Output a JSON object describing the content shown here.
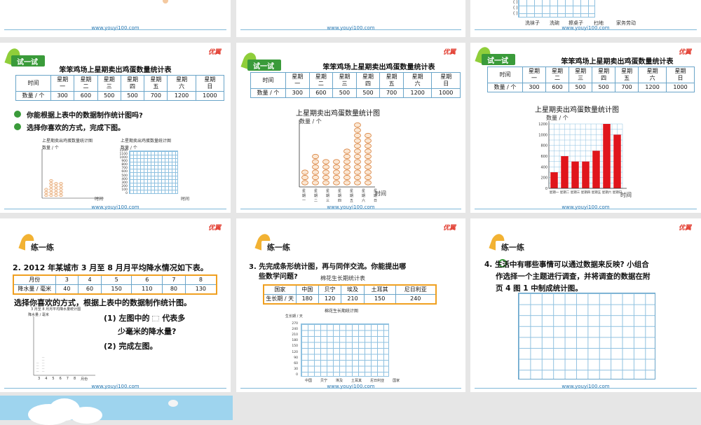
{
  "footer_url": "www.youyi100.com",
  "logo_text": "优翼",
  "top_right_chart_labels": {
    "tick_values": [
      "( )",
      "( )",
      "( )"
    ],
    "categories": [
      "洗袜子",
      "洗碗",
      "擦桌子",
      "扫地",
      "家务劳动"
    ]
  },
  "egg_table": {
    "title": "笨笨鸡场上星期卖出鸡蛋数量统计表",
    "header_label": "时间",
    "row_label": "数量 / 个",
    "days": [
      "星期一",
      "星期二",
      "星期三",
      "星期四",
      "星期五",
      "星期六",
      "星期日"
    ],
    "days_split": [
      [
        "星期",
        "一"
      ],
      [
        "星期",
        "二"
      ],
      [
        "星期",
        "三"
      ],
      [
        "星期",
        "四"
      ],
      [
        "星期",
        "五"
      ],
      [
        "星期",
        "六"
      ],
      [
        "星期",
        "日"
      ]
    ],
    "values": [
      "300",
      "600",
      "500",
      "500",
      "700",
      "1200",
      "1000"
    ]
  },
  "slide4": {
    "badge": "试一试",
    "q1": "你能根据上表中的数据制作统计图吗?",
    "q2": "选择你喜欢的方式，完成下图。",
    "mini_chart_title": "上星期卖出鸡蛋数量统计图",
    "y_label": "数量 / 个",
    "x_label": "时间",
    "y_ticks": [
      "1200",
      "1100",
      "1000",
      "900",
      "800",
      "700",
      "600",
      "500",
      "400",
      "300",
      "200",
      "100",
      "0"
    ]
  },
  "slide5": {
    "badge": "试一试",
    "chart_title": "上星期卖出鸡蛋数量统计图",
    "y_label": "数量 / 个",
    "x_label": "时间"
  },
  "slide6": {
    "badge": "试一试",
    "chart_title": "上星期卖出鸡蛋数量统计图",
    "y_label": "数量 / 个",
    "x_label": "时间",
    "y_ticks": [
      "1200",
      "1000",
      "800",
      "600",
      "400",
      "200",
      "0"
    ]
  },
  "slide7": {
    "badge": "练一练",
    "question": "2. 2012 年某城市 3 月至 8 月月平均降水情况如下表。",
    "row1_label": "月份",
    "months": [
      "3",
      "4",
      "5",
      "6",
      "7",
      "8"
    ],
    "row2_label": "降水量 / 毫米",
    "rain": [
      "40",
      "60",
      "150",
      "110",
      "80",
      "130"
    ],
    "instruction": "选择你喜欢的方式，根据上表中的数据制作统计图。",
    "sub1a": "(1) 左图中的",
    "sub1b": "代表多",
    "sub1c": "少毫米的降水量?",
    "sub2": "(2) 完成左图。",
    "mini_title": "3 月至 8 月月平均降水量统计图",
    "mini_y": "降水量 / 毫米",
    "mini_x": "月份"
  },
  "slide8": {
    "badge": "练一练",
    "question_l1": "3. 先完成条形统计图，再与同伴交流。你能提出哪",
    "question_l2": "些数学问题?",
    "table_title": "棉花生长期统计表",
    "row1_label": "国家",
    "countries": [
      "中国",
      "贝宁",
      "埃及",
      "土耳其",
      "尼日利亚"
    ],
    "row2_label": "生长期 / 天",
    "days": [
      "180",
      "120",
      "210",
      "150",
      "240"
    ],
    "chart_title": "棉花生长期统计图",
    "y_label": "生长期 / 天",
    "y_ticks": [
      "270",
      "240",
      "210",
      "180",
      "150",
      "120",
      "90",
      "60",
      "30",
      "0"
    ],
    "x_label": "国家"
  },
  "slide9": {
    "badge": "练一练",
    "q_l1": "4. 生活中有哪些事情可以通过数据来反映? 小组合",
    "q_l2": "作选择一个主题进行调查，并将调查的数据在附",
    "q_l3": "页 4 图 1 中制成统计图。"
  },
  "chart_data": [
    {
      "type": "bar",
      "title": "上星期卖出鸡蛋数量统计图",
      "categories": [
        "星期一",
        "星期二",
        "星期三",
        "星期四",
        "星期五",
        "星期六",
        "星期日"
      ],
      "values": [
        300,
        600,
        500,
        500,
        700,
        1200,
        1000
      ],
      "xlabel": "时间",
      "ylabel": "数量 / 个",
      "ylim": [
        0,
        1200
      ],
      "grid": true,
      "bar_color": "#e0151b"
    }
  ]
}
